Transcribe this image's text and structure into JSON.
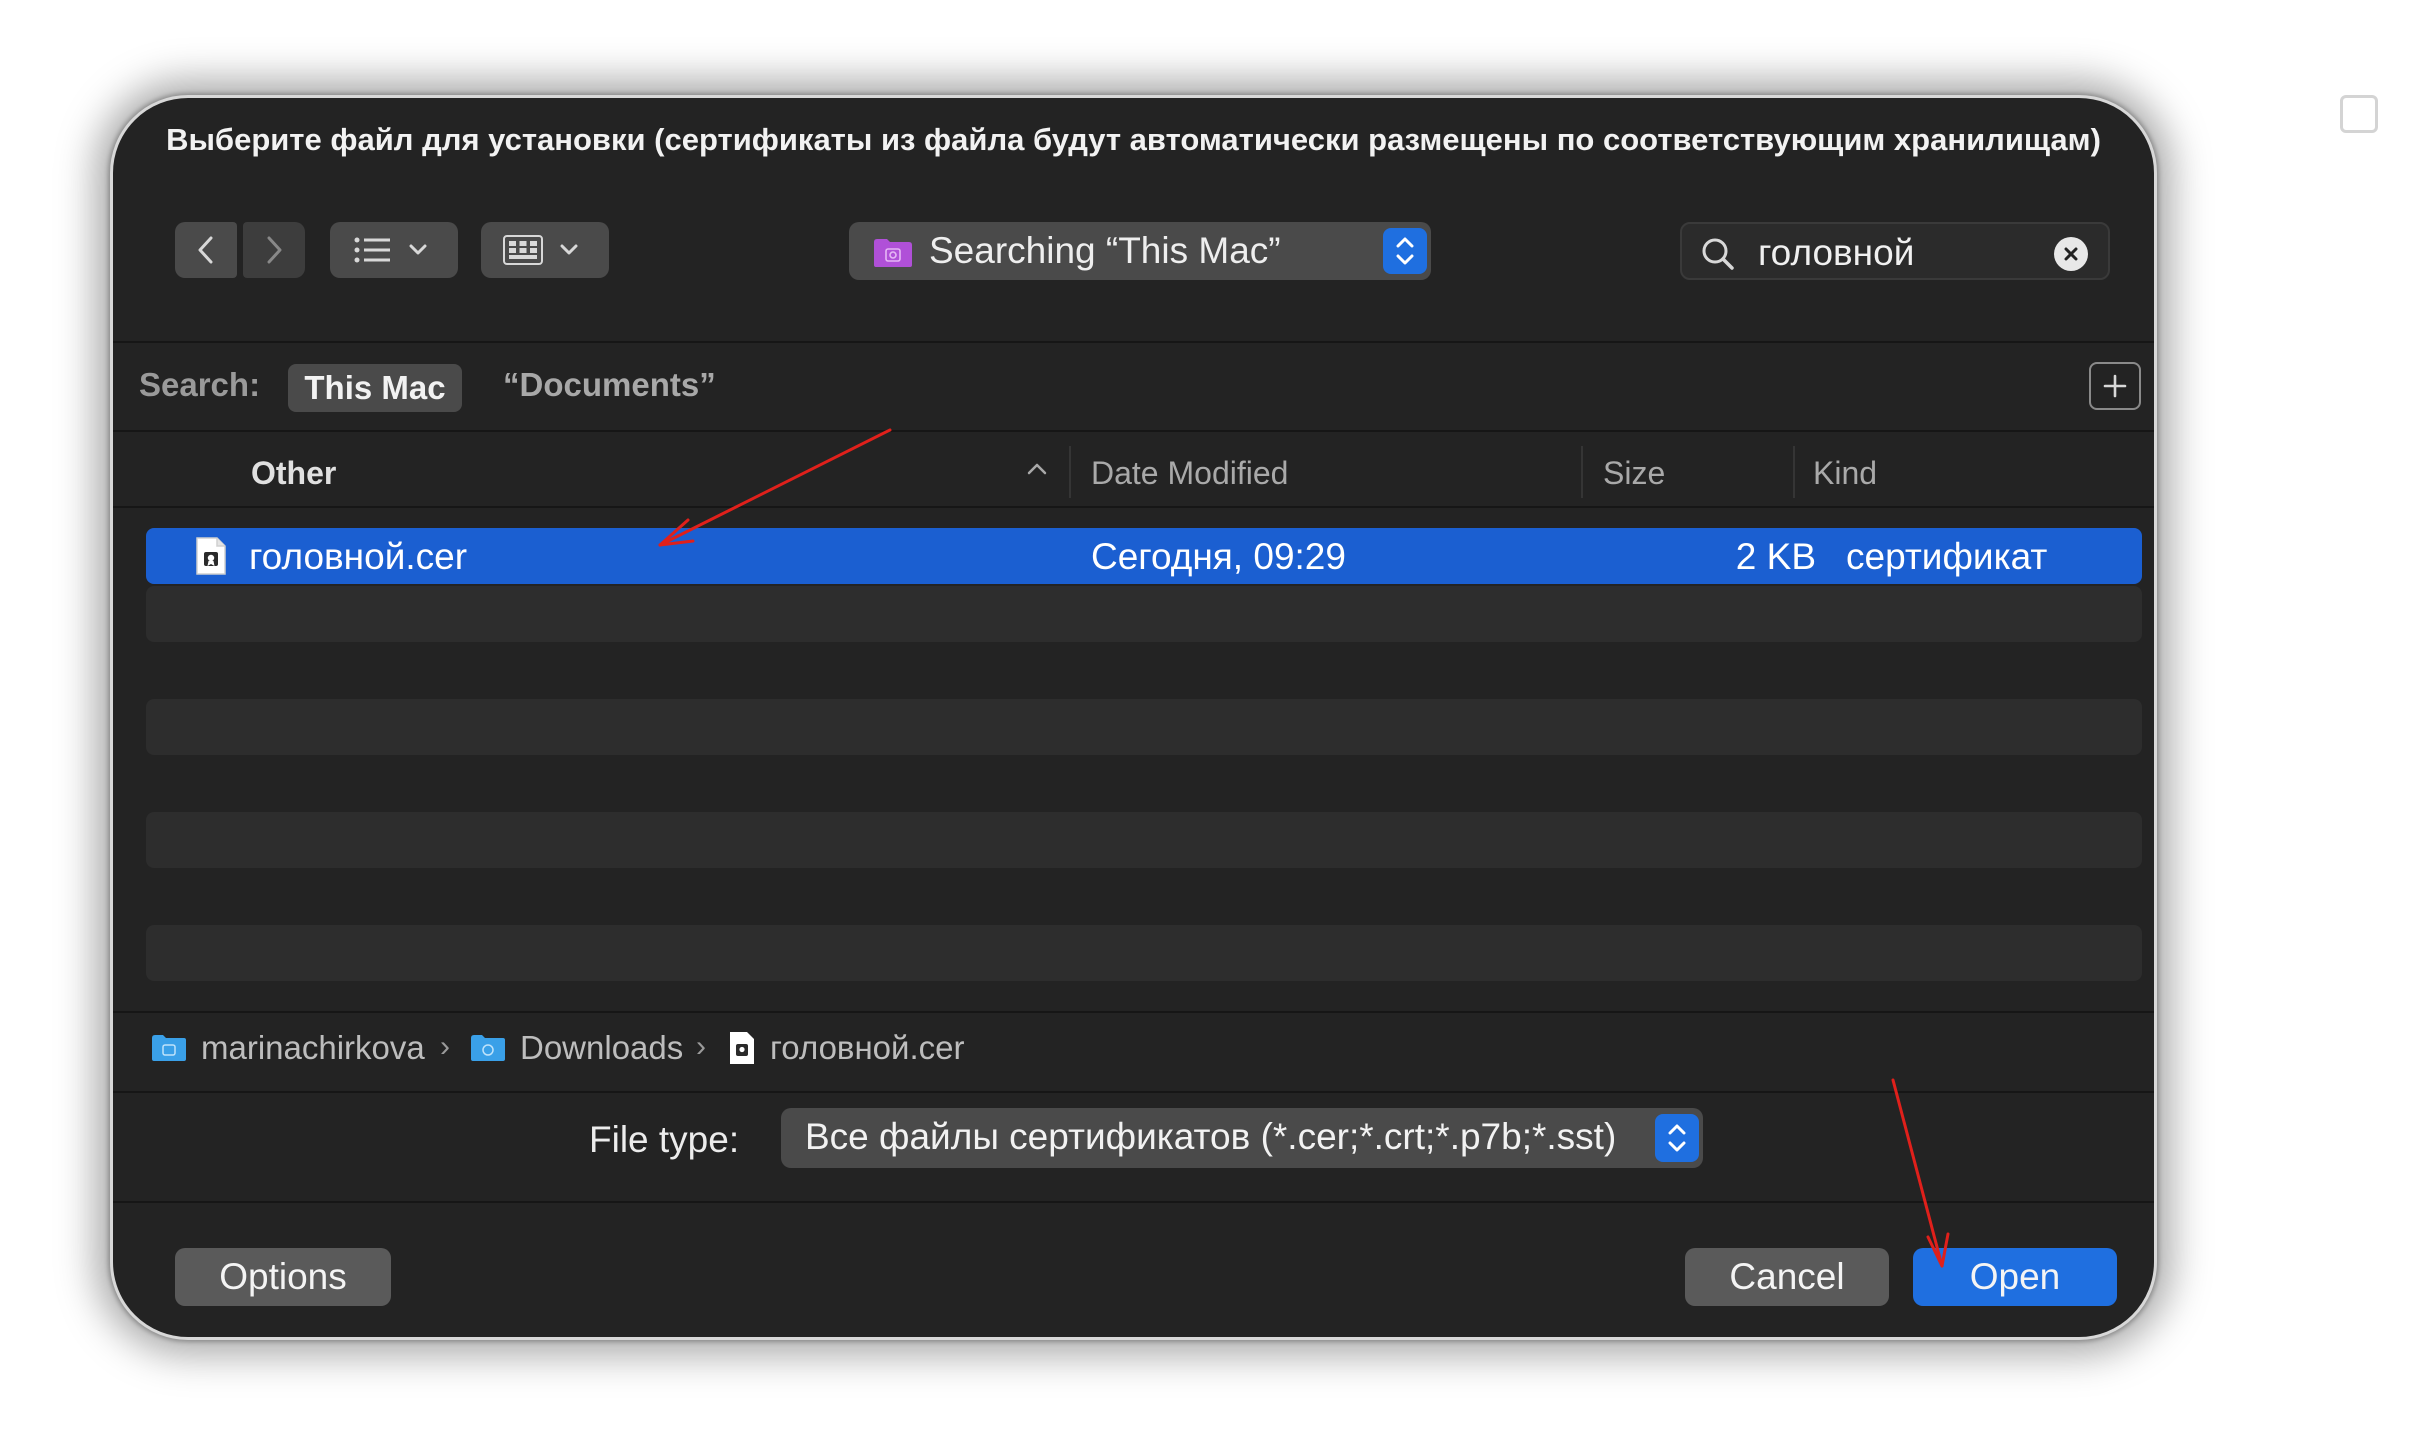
{
  "dialog": {
    "title": "Выберите файл для установки (сертификаты из файла будут автоматически размещены по соответствующим хранилищам)"
  },
  "toolbar": {
    "location_label": "Searching “This Mac”",
    "search_value": "головной"
  },
  "scope": {
    "label": "Search:",
    "this_mac": "This Mac",
    "documents": "“Documents”"
  },
  "columns": {
    "name": "Other",
    "date": "Date Modified",
    "size": "Size",
    "kind": "Kind"
  },
  "files": [
    {
      "name": "головной.cer",
      "date": "Сегодня, 09:29",
      "size": "2 KB",
      "kind": "сертификат",
      "selected": true
    }
  ],
  "path": {
    "items": [
      "marinachirkova",
      "Downloads",
      "головной.cer"
    ],
    "separator": "›"
  },
  "file_type": {
    "label": "File type:",
    "value": "Все файлы сертификатов (*.cer;*.crt;*.p7b;*.sst)"
  },
  "buttons": {
    "options": "Options",
    "cancel": "Cancel",
    "open": "Open"
  },
  "colors": {
    "accent": "#1f6fe0",
    "selection": "#1b5fd1",
    "annotation_arrow": "#e0201b",
    "folder_location": "#b050d8",
    "folder_path": "#3aa0e8"
  },
  "icons": {
    "back": "chevron-left-icon",
    "forward": "chevron-right-icon",
    "list_view": "list-view-icon",
    "grid_view": "grid-view-icon",
    "search": "magnifier-icon",
    "clear": "clear-circle-icon",
    "add": "plus-icon",
    "file": "certificate-file-icon",
    "folder": "folder-icon"
  }
}
